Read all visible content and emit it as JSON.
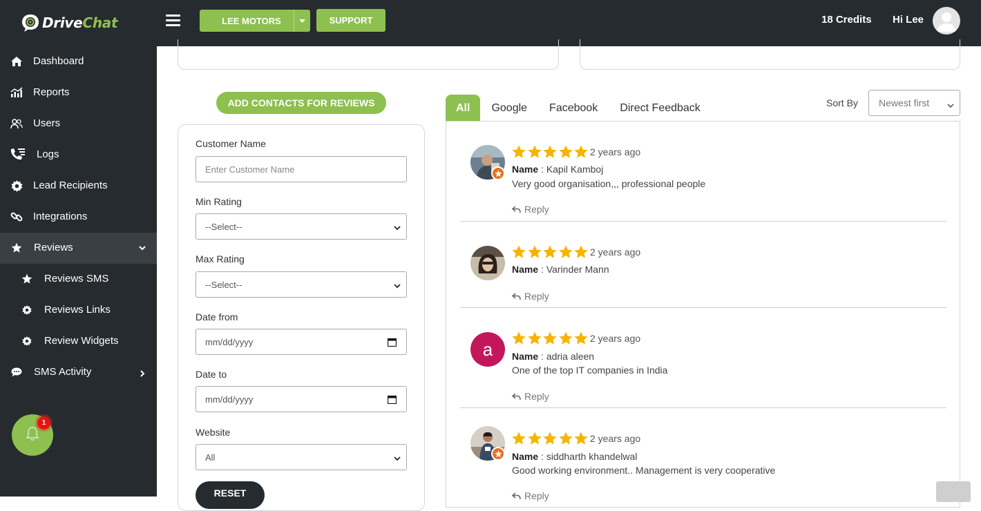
{
  "brand": {
    "name_part1": "Drive",
    "name_part2": "Chat",
    "accent": "#8dc04f"
  },
  "topbar": {
    "dealer": "LEE MOTORS",
    "support": "SUPPORT",
    "credits": "18 Credits",
    "greeting": "Hi Lee"
  },
  "sidebar": {
    "items": [
      {
        "label": "Dashboard",
        "icon": "home-icon"
      },
      {
        "label": "Reports",
        "icon": "bar-chart-icon"
      },
      {
        "label": "Users",
        "icon": "users-icon"
      },
      {
        "label": "Logs",
        "icon": "phone-list-icon"
      },
      {
        "label": "Lead Recipients",
        "icon": "gear-icon"
      },
      {
        "label": "Integrations",
        "icon": "link-icon"
      },
      {
        "label": "Reviews",
        "icon": "star-icon",
        "expanded": true
      },
      {
        "label": "Reviews SMS",
        "icon": "star-icon"
      },
      {
        "label": "Reviews Links",
        "icon": "gear-icon"
      },
      {
        "label": "Review Widgets",
        "icon": "gear-icon"
      },
      {
        "label": "SMS Activity",
        "icon": "chat-icon"
      }
    ],
    "notification_count": "1"
  },
  "filters": {
    "add_contacts": "ADD CONTACTS FOR REVIEWS",
    "customer_name_label": "Customer Name",
    "customer_name_placeholder": "Enter Customer Name",
    "min_rating_label": "Min Rating",
    "min_rating_value": "--Select--",
    "max_rating_label": "Max Rating",
    "max_rating_value": "--Select--",
    "date_from_label": "Date from",
    "date_from_value": "mm/dd/yyyy",
    "date_to_label": "Date to",
    "date_to_value": "mm/dd/yyyy",
    "website_label": "Website",
    "website_value": "All",
    "reset": "RESET"
  },
  "tabs": [
    "All",
    "Google",
    "Facebook",
    "Direct Feedback"
  ],
  "sort": {
    "label": "Sort By",
    "value": "Newest first"
  },
  "reviews": [
    {
      "rating": 5,
      "ago": "2 years ago",
      "name_label": "Name",
      "name": "Kapil Kamboj",
      "text": "Very good organisation,,, professional people",
      "reply": "Reply"
    },
    {
      "rating": 5,
      "ago": "2 years ago",
      "name_label": "Name",
      "name": "Varinder Mann",
      "text": "",
      "reply": "Reply"
    },
    {
      "rating": 5,
      "ago": "2 years ago",
      "name_label": "Name",
      "name": "adria aleen",
      "text": "One of the top IT companies in India",
      "reply": "Reply",
      "initial": "a"
    },
    {
      "rating": 5,
      "ago": "2 years ago",
      "name_label": "Name",
      "name": "siddharth khandelwal",
      "text": "Good working environment.. Management is very cooperative",
      "reply": "Reply"
    }
  ]
}
